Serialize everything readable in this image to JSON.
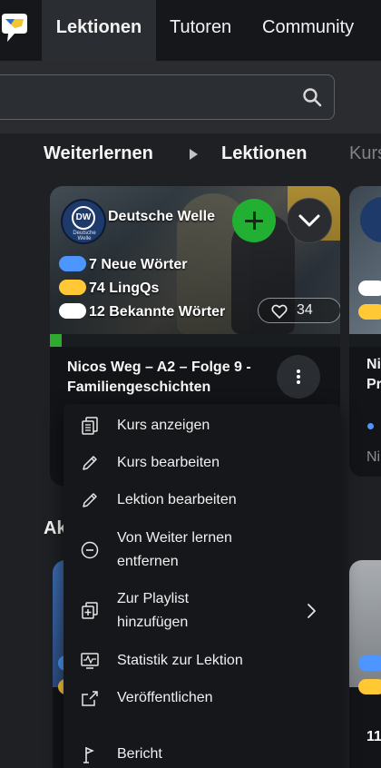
{
  "nav": {
    "tabs": [
      {
        "label": "Lektionen",
        "active": true
      },
      {
        "label": "Tutoren"
      },
      {
        "label": "Community"
      }
    ]
  },
  "search": {
    "placeholder": "",
    "value": ""
  },
  "breadcrumb": [
    "Weiterlernen",
    "Lektionen",
    "Kurs"
  ],
  "lesson_card": {
    "provider": "Deutsche Welle",
    "badge_text": "DW",
    "badge_caption": "Deutsche Welle",
    "stats": {
      "new_words": "7 Neue Wörter",
      "lingqs": "74 LingQs",
      "known_words": "12 Bekannte Wörter"
    },
    "likes": "34",
    "progress": 0.04,
    "title": "Nicos Weg – A2 – Folge 9 - Familiengeschichten"
  },
  "peek_card": {
    "title_start": "Ni",
    "title_line2": "Pr",
    "footer": "Ni"
  },
  "section_heading": "Ak",
  "peek_card2": {
    "title_start": "11"
  },
  "menu": {
    "items": [
      {
        "label": "Kurs anzeigen",
        "icon": "copy-icon"
      },
      {
        "label": "Kurs bearbeiten",
        "icon": "pencil-icon"
      },
      {
        "label": "Lektion bearbeiten",
        "icon": "pencil-icon"
      },
      {
        "label": "Von Weiter lernen entfernen",
        "line1": "Von Weiter lernen",
        "line2": "entfernen",
        "icon": "minus-circle-icon"
      },
      {
        "label": "Zur Playlist hinzufügen",
        "line1": "Zur Playlist",
        "line2": "hinzufügen",
        "icon": "playlist-add-icon",
        "submenu": true
      },
      {
        "label": "Statistik zur Lektion",
        "icon": "stats-monitor-icon"
      },
      {
        "label": "Veröffentlichen",
        "icon": "share-icon"
      },
      {
        "label": "Bericht",
        "icon": "flag-icon"
      }
    ]
  },
  "colors": {
    "accent_green": "#22b033",
    "new_words_blue": "#4d96ff",
    "lingq_yellow": "#ffc834",
    "background": "#1e2023"
  }
}
